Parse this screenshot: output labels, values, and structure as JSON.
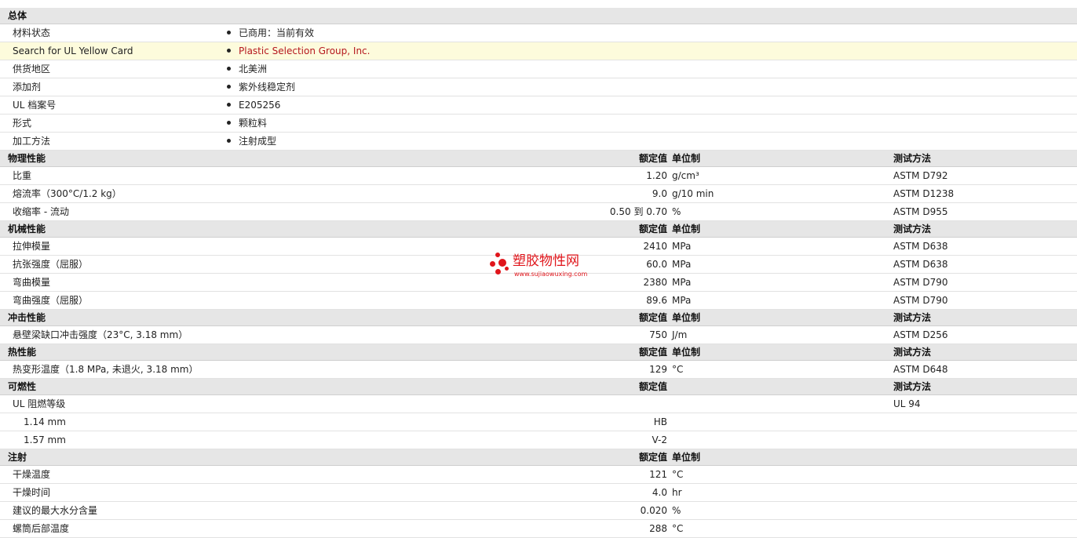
{
  "general": {
    "title": "总体",
    "rows": [
      {
        "label": "材料状态",
        "value": "已商用：当前有效"
      },
      {
        "label": "Search for UL Yellow Card",
        "value": "Plastic Selection Group, Inc."
      },
      {
        "label": "供货地区",
        "value": "北美洲"
      },
      {
        "label": "添加剂",
        "value": "紫外线稳定剂"
      },
      {
        "label": "UL 档案号",
        "value": "E205256"
      },
      {
        "label": "形式",
        "value": "颗粒料"
      },
      {
        "label": "加工方法",
        "value": "注射成型"
      }
    ]
  },
  "headers": {
    "nominal": "额定值",
    "unit": "单位制",
    "test": "测试方法"
  },
  "physical": {
    "title": "物理性能",
    "rows": [
      {
        "label": "比重",
        "value": "1.20",
        "unit": "g/cm³",
        "test": "ASTM D792"
      },
      {
        "label": "熔流率（300°C/1.2 kg）",
        "value": "9.0",
        "unit": "g/10 min",
        "test": "ASTM D1238"
      },
      {
        "label": "收缩率 - 流动",
        "value": "0.50 到  0.70",
        "unit": "%",
        "test": "ASTM D955"
      }
    ]
  },
  "mechanical": {
    "title": "机械性能",
    "rows": [
      {
        "label": "拉伸模量",
        "value": "2410",
        "unit": "MPa",
        "test": "ASTM D638"
      },
      {
        "label": "抗张强度（屈服）",
        "value": "60.0",
        "unit": "MPa",
        "test": "ASTM D638"
      },
      {
        "label": "弯曲模量",
        "value": "2380",
        "unit": "MPa",
        "test": "ASTM D790"
      },
      {
        "label": "弯曲强度（屈服）",
        "value": "89.6",
        "unit": "MPa",
        "test": "ASTM D790"
      }
    ]
  },
  "impact": {
    "title": "冲击性能",
    "rows": [
      {
        "label": "悬壁梁缺口冲击强度（23°C, 3.18 mm）",
        "value": "750",
        "unit": "J/m",
        "test": "ASTM D256"
      }
    ]
  },
  "thermal": {
    "title": "热性能",
    "rows": [
      {
        "label": "热变形温度（1.8 MPa, 未退火, 3.18 mm）",
        "value": "129",
        "unit": "°C",
        "test": "ASTM D648"
      }
    ]
  },
  "flammability": {
    "title": "可燃性",
    "rows": [
      {
        "label": "UL 阻燃等级",
        "value": "",
        "test": "UL 94"
      },
      {
        "label": "1.14 mm",
        "value": "HB",
        "test": ""
      },
      {
        "label": "1.57 mm",
        "value": "V-2",
        "test": ""
      }
    ]
  },
  "injection": {
    "title": "注射",
    "rows": [
      {
        "label": "干燥温度",
        "value": "121",
        "unit": "°C"
      },
      {
        "label": "干燥时间",
        "value": "4.0",
        "unit": "hr"
      },
      {
        "label": "建议的最大水分含量",
        "value": "0.020",
        "unit": "%"
      },
      {
        "label": "螺筒后部温度",
        "value": "288",
        "unit": "°C"
      }
    ]
  },
  "watermark": {
    "name": "塑胶物性网",
    "url": "www.sujiaowuxing.com",
    "color": "#e0151b"
  },
  "colors": {
    "section_bg": "#e6e6e6",
    "highlight_bg": "#fdfbdc",
    "link": "#b5181e"
  }
}
